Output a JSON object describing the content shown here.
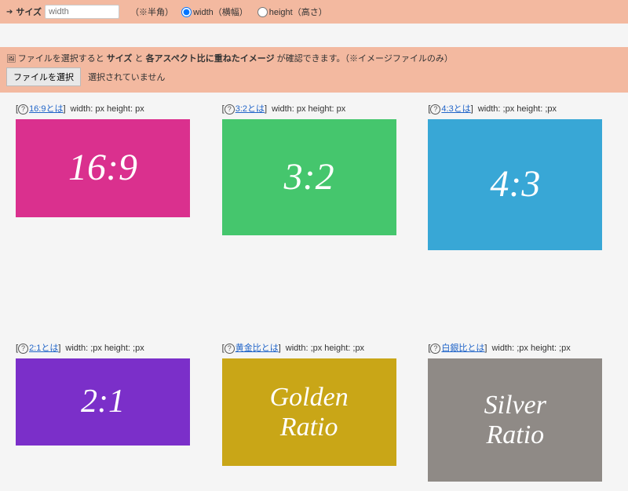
{
  "top": {
    "size_label": "サイズ",
    "size_placeholder": "width",
    "half_width_note": "（※半角）",
    "radio_width_label": "width（横幅）",
    "radio_height_label": "height（高さ）"
  },
  "upload": {
    "desc_pre": "ファイルを選択すると ",
    "desc_bold1": "サイズ",
    "desc_mid": " と ",
    "desc_bold2": "各アスペクト比に重ねたイメージ",
    "desc_post": " が確認できます。（※イメージファイルのみ）",
    "button_label": "ファイルを選択",
    "status": "選択されていません"
  },
  "cells": [
    {
      "link": "16:9とは",
      "dims": "width:  px   height:  px",
      "label": "16:9",
      "cls": "r-16-9"
    },
    {
      "link": "3:2とは",
      "dims": "width:  px   height:  px",
      "label": "3:2",
      "cls": "r-3-2"
    },
    {
      "link": "4:3とは",
      "dims": "width: ;px   height: ;px",
      "label": "4:3",
      "cls": "r-4-3"
    },
    {
      "link": "2:1とは",
      "dims": "width: ;px   height: ;px",
      "label": "2:1",
      "cls": "r-2-1"
    },
    {
      "link": "黄金比とは",
      "dims": "width: ;px   height: ;px",
      "label": "Golden\nRatio",
      "cls": "r-gold"
    },
    {
      "link": "白銀比とは",
      "dims": "width: ;px   height: ;px",
      "label": "Silver\nRatio",
      "cls": "r-silver"
    }
  ]
}
